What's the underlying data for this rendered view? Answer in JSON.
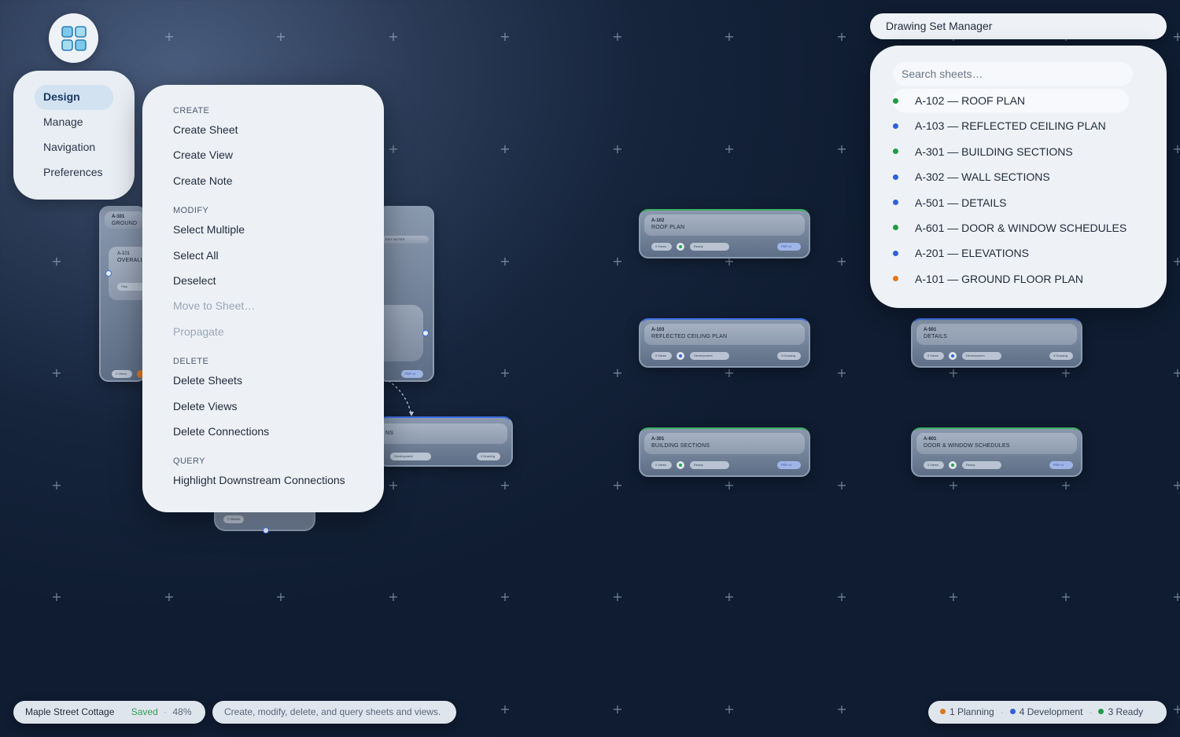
{
  "app": {
    "icon": "grid-app-icon",
    "accent": "#3b82c4"
  },
  "nav": {
    "items": [
      {
        "label": "Design",
        "active": true
      },
      {
        "label": "Manage",
        "active": false
      },
      {
        "label": "Navigation",
        "active": false
      },
      {
        "label": "Preferences",
        "active": false
      }
    ]
  },
  "menu": {
    "sections": [
      {
        "title": "CREATE",
        "items": [
          {
            "label": "Create Sheet",
            "enabled": true
          },
          {
            "label": "Create View",
            "enabled": true
          },
          {
            "label": "Create Note",
            "enabled": true
          }
        ]
      },
      {
        "title": "MODIFY",
        "items": [
          {
            "label": "Select Multiple",
            "enabled": true
          },
          {
            "label": "Select All",
            "enabled": true
          },
          {
            "label": "Deselect",
            "enabled": true
          },
          {
            "label": "Move to Sheet…",
            "enabled": false
          },
          {
            "label": "Propagate",
            "enabled": false
          }
        ]
      },
      {
        "title": "DELETE",
        "items": [
          {
            "label": "Delete Sheets",
            "enabled": true
          },
          {
            "label": "Delete Views",
            "enabled": true
          },
          {
            "label": "Delete Connections",
            "enabled": true
          }
        ]
      },
      {
        "title": "QUERY",
        "items": [
          {
            "label": "Highlight Downstream Connections",
            "enabled": true
          }
        ]
      }
    ]
  },
  "canvas": {
    "nodes": [
      {
        "code": "A-102",
        "name": "ROOF PLAN",
        "views": "0 Views",
        "status": "Ready",
        "tag": "PDF v1",
        "tag_blue": true,
        "color": "green"
      },
      {
        "code": "A-103",
        "name": "REFLECTED CEILING PLAN",
        "views": "0 Views",
        "status": "Development",
        "tag": "0 Drawing",
        "tag_blue": false,
        "color": "blue"
      },
      {
        "code": "A-501",
        "name": "DETAILS",
        "views": "0 Views",
        "status": "Development",
        "tag": "0 Drawing",
        "tag_blue": false,
        "color": "blue"
      },
      {
        "code": "A-301",
        "name": "BUILDING SECTIONS",
        "views": "0 Views",
        "status": "Ready",
        "tag": "PDF v1",
        "tag_blue": true,
        "color": "green"
      },
      {
        "code": "A-601",
        "name": "DOOR & WINDOW SCHEDULES",
        "views": "0 Views",
        "status": "Ready",
        "tag": "PDF v1",
        "tag_blue": true,
        "color": "green"
      }
    ],
    "partial": {
      "ground_code": "A-101",
      "ground_name": "GROUND",
      "overall_code": "A-101",
      "overall_name": "OVERALL",
      "plan_pill": "Plan",
      "views_pill": "2 Views",
      "notes_pill": "ENT NOTES",
      "pdf_pill": "PDF v1",
      "sections_suffix": "NS",
      "sections_status": "Development",
      "sections_tag": "0 Drawing",
      "sheets_pill": "2 Sheets"
    }
  },
  "manager": {
    "title": "Drawing Set Manager",
    "search_placeholder": "Search sheets…",
    "sheets": [
      {
        "label": "A-102 — ROOF PLAN",
        "status": "ready",
        "selected": true
      },
      {
        "label": "A-103 — REFLECTED CEILING PLAN",
        "status": "development",
        "selected": false
      },
      {
        "label": "A-301 — BUILDING SECTIONS",
        "status": "ready",
        "selected": false
      },
      {
        "label": "A-302 — WALL SECTIONS",
        "status": "development",
        "selected": false
      },
      {
        "label": "A-501 — DETAILS",
        "status": "development",
        "selected": false
      },
      {
        "label": "A-601 — DOOR & WINDOW SCHEDULES",
        "status": "ready",
        "selected": false
      },
      {
        "label": "A-201 — ELEVATIONS",
        "status": "development",
        "selected": false
      },
      {
        "label": "A-101 — GROUND FLOOR PLAN",
        "status": "planning",
        "selected": false
      }
    ]
  },
  "status_colors": {
    "planning": "#e0761e",
    "development": "#2f62d6",
    "ready": "#1f9a46"
  },
  "footer": {
    "project_name": "Maple Street Cottage",
    "saved": "Saved",
    "zoom": "48%",
    "hint": "Create, modify, delete, and query sheets and views.",
    "legend": [
      {
        "label": "1 Planning",
        "status": "planning"
      },
      {
        "label": "4 Development",
        "status": "development"
      },
      {
        "label": "3 Ready",
        "status": "ready"
      }
    ]
  }
}
